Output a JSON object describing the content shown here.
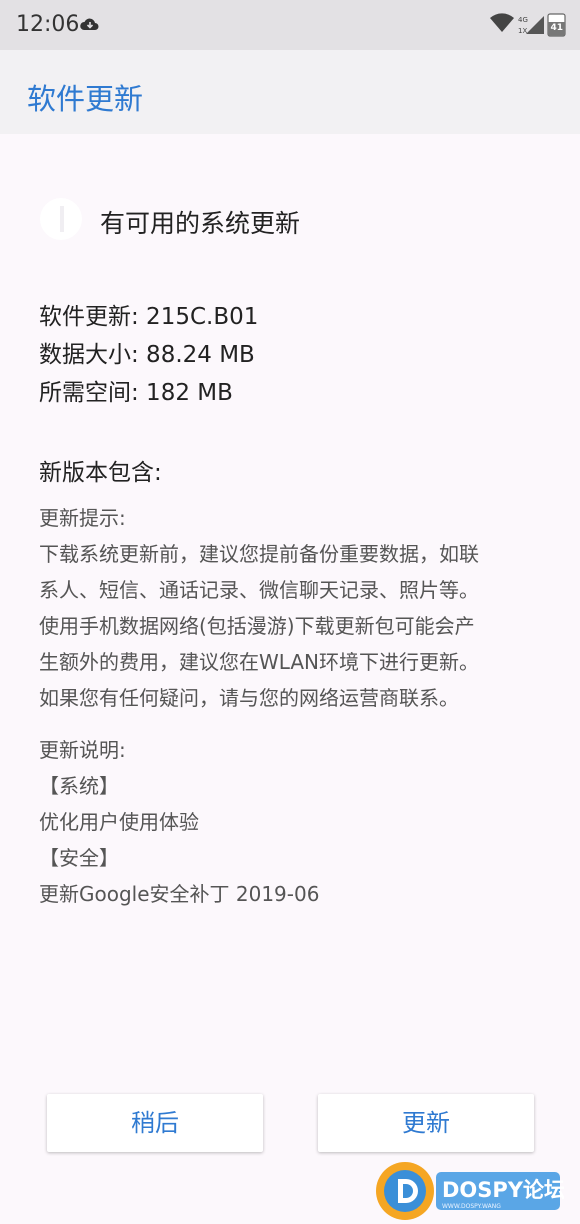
{
  "status_bar": {
    "time": "12:06",
    "network_label_top": "4G",
    "network_label_bottom": "1X",
    "battery": "41",
    "icons": [
      "download-cloud-icon",
      "wifi-icon",
      "cellular-icon",
      "battery-icon"
    ]
  },
  "app_bar": {
    "title": "软件更新"
  },
  "update": {
    "title": "有可用的系统更新",
    "icon": "system-update-icon"
  },
  "info": {
    "version": "软件更新: 215C.B01",
    "data_size": "数据大小: 88.24 MB",
    "required_space": "所需空间: 182 MB"
  },
  "contents": {
    "heading": "新版本包含:",
    "tips": {
      "label": "更新提示:",
      "lines": [
        "下载系统更新前，建议您提前备份重要数据，如联",
        "系人、短信、通话记录、微信聊天记录、照片等。",
        "使用手机数据网络(包括漫游)下载更新包可能会产",
        "生额外的费用，建议您在WLAN环境下进行更新。",
        "如果您有任何疑问，请与您的网络运营商联系。"
      ]
    },
    "notes": {
      "label": "更新说明:",
      "lines": [
        "【系统】",
        "优化用户使用体验",
        "【安全】",
        "更新Google安全补丁 2019-06"
      ]
    }
  },
  "buttons": {
    "later": "稍后",
    "update": "更新"
  },
  "watermark": {
    "brand": "DOSPY论坛",
    "sub": "WWW.DOSPY.WANG"
  },
  "colors": {
    "accent": "#2f7ad1",
    "background": "#fcf8fc",
    "status_bar": "#e3e1e4"
  }
}
